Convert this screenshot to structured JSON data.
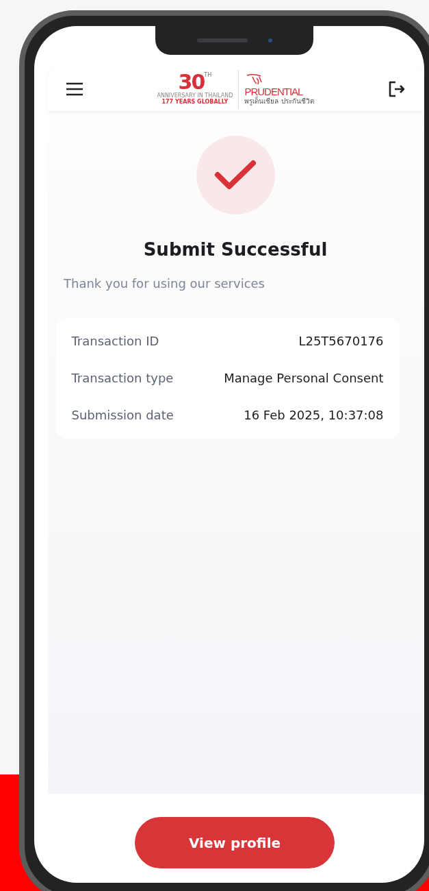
{
  "header": {
    "logo": {
      "anniversary_number": "30",
      "anniversary_suffix": "TH",
      "anniversary_line": "ANNIVERSARY IN THAILAND",
      "globally_line": "177 YEARS GLOBALLY",
      "brand": "PRUDENTIAL",
      "tagline": "พรูเด็นเชียล ประกันชีวิต"
    }
  },
  "result": {
    "title": "Submit Successful",
    "subtitle": "Thank you for using our services"
  },
  "details": [
    {
      "label": "Transaction ID",
      "value": "L25T5670176"
    },
    {
      "label": "Transaction type",
      "value": "Manage Personal Consent"
    },
    {
      "label": "Submission date",
      "value": "16 Feb 2025, 10:37:08"
    }
  ],
  "buttons": [
    {
      "label": "View profile"
    }
  ]
}
